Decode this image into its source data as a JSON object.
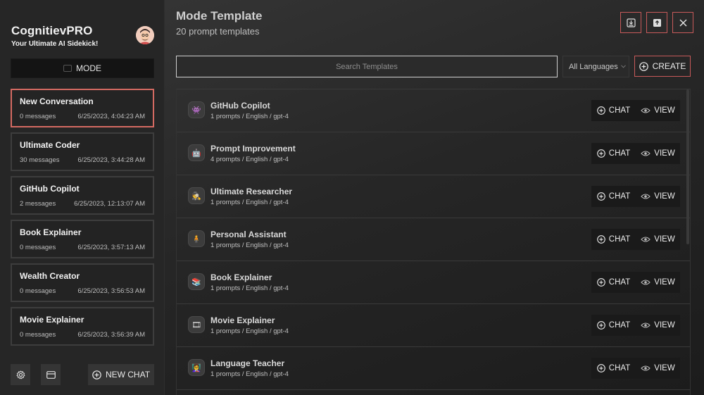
{
  "brand": {
    "title": "CognitievPRO",
    "subtitle": "Your Ultimate AI Sidekick!"
  },
  "sidebar": {
    "mode_label": "MODE",
    "conversations": [
      {
        "title": "New Conversation",
        "messages": "0 messages",
        "date": "6/25/2023, 4:04:23 AM",
        "active": true
      },
      {
        "title": "Ultimate Coder",
        "messages": "30 messages",
        "date": "6/25/2023, 3:44:28 AM"
      },
      {
        "title": "GitHub Copilot",
        "messages": "2 messages",
        "date": "6/25/2023, 12:13:07 AM"
      },
      {
        "title": "Book Explainer",
        "messages": "0 messages",
        "date": "6/25/2023, 3:57:13 AM"
      },
      {
        "title": "Wealth Creator",
        "messages": "0 messages",
        "date": "6/25/2023, 3:56:53 AM"
      },
      {
        "title": "Movie Explainer",
        "messages": "0 messages",
        "date": "6/25/2023, 3:56:39 AM"
      }
    ],
    "new_chat_label": "NEW CHAT"
  },
  "main": {
    "title": "Mode Template",
    "subtitle": "20 prompt templates",
    "search_placeholder": "Search Templates",
    "language_select": "All Languages",
    "create_label": "CREATE",
    "chat_label": "CHAT",
    "view_label": "VIEW",
    "templates": [
      {
        "name": "GitHub Copilot",
        "meta": "1 prompts / English / gpt-4",
        "icon": "alien-icon"
      },
      {
        "name": "Prompt Improvement",
        "meta": "4 prompts / English / gpt-4",
        "icon": "robot-icon"
      },
      {
        "name": "Ultimate Researcher",
        "meta": "1 prompts / English / gpt-4",
        "icon": "detective-icon"
      },
      {
        "name": "Personal Assistant",
        "meta": "1 prompts / English / gpt-4",
        "icon": "person-icon"
      },
      {
        "name": "Book Explainer",
        "meta": "1 prompts / English / gpt-4",
        "icon": "books-icon"
      },
      {
        "name": "Movie Explainer",
        "meta": "1 prompts / English / gpt-4",
        "icon": "film-icon"
      },
      {
        "name": "Language Teacher",
        "meta": "1 prompts / English / gpt-4",
        "icon": "teacher-icon"
      }
    ]
  },
  "colors": {
    "accent": "#d46a62",
    "background": "#1d1d1d",
    "sidebar": "#262626"
  }
}
